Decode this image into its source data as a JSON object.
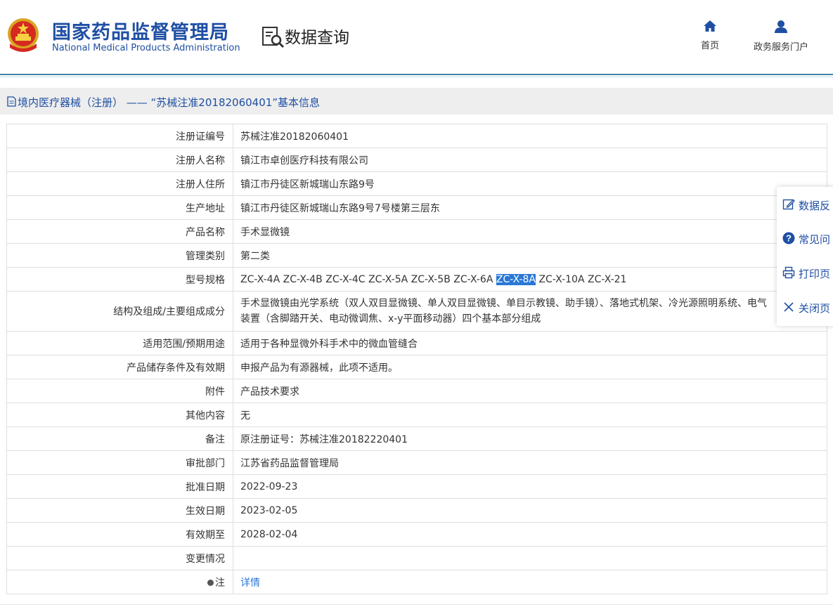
{
  "header": {
    "brand_cn": "国家药品监督管理局",
    "brand_en": "National Medical Products Administration",
    "section_title": "数据查询",
    "nav": [
      {
        "label": "首页",
        "icon": "home-icon"
      },
      {
        "label": "政务服务门户",
        "icon": "user-icon"
      }
    ]
  },
  "breadcrumb": {
    "text": "境内医疗器械（注册） —— “苏械注准20182060401”基本信息",
    "icon": "document-icon"
  },
  "record": {
    "registration_no": {
      "label": "注册证编号",
      "value": "苏械注准20182060401"
    },
    "registrant_name": {
      "label": "注册人名称",
      "value": "镇江市卓创医疗科技有限公司"
    },
    "registrant_address": {
      "label": "注册人住所",
      "value": "镇江市丹徒区新城瑞山东路9号"
    },
    "production_address": {
      "label": "生产地址",
      "value": "镇江市丹徒区新城瑞山东路9号7号楼第三层东"
    },
    "product_name": {
      "label": "产品名称",
      "value": "手术显微镜"
    },
    "management_class": {
      "label": "管理类别",
      "value": "第二类"
    },
    "model_spec": {
      "label": "型号规格",
      "before": "ZC-X-4A ZC-X-4B ZC-X-4C ZC-X-5A ZC-X-5B ZC-X-6A ",
      "highlight": "ZC-X-8A",
      "after": " ZC-X-10A ZC-X-21"
    },
    "structure": {
      "label": "结构及组成/主要组成成分",
      "value": "手术显微镜由光学系统（双人双目显微镜、单人双目显微镜、单目示教镜、助手镜）、落地式机架、冷光源照明系统、电气装置（含脚踏开关、电动微调焦、x-y平面移动器）四个基本部分组成"
    },
    "scope": {
      "label": "适用范围/预期用途",
      "value": "适用于各种显微外科手术中的微血管缝合"
    },
    "storage": {
      "label": "产品储存条件及有效期",
      "value": "申报产品为有源器械，此项不适用。"
    },
    "attachment": {
      "label": "附件",
      "value": "产品技术要求"
    },
    "other": {
      "label": "其他内容",
      "value": "无"
    },
    "remarks": {
      "label": "备注",
      "value": "原注册证号：苏械注准20182220401"
    },
    "approval_dept": {
      "label": "审批部门",
      "value": "江苏省药品监督管理局"
    },
    "approval_date": {
      "label": "批准日期",
      "value": "2022-09-23"
    },
    "effective_date": {
      "label": "生效日期",
      "value": "2023-02-05"
    },
    "valid_until": {
      "label": "有效期至",
      "value": "2028-02-04"
    },
    "change": {
      "label": "变更情况",
      "value": ""
    },
    "note": {
      "label": "注",
      "value": "详情"
    }
  },
  "float_panel": [
    {
      "label": "数据反",
      "icon": "edit-icon"
    },
    {
      "label": "常见问",
      "icon": "question-icon"
    },
    {
      "label": "打印页",
      "icon": "print-icon"
    },
    {
      "label": "关闭页",
      "icon": "close-icon"
    }
  ],
  "colors": {
    "brand": "#1f4fa3",
    "link": "#2a78d6",
    "highlight": "#2a78d6"
  }
}
